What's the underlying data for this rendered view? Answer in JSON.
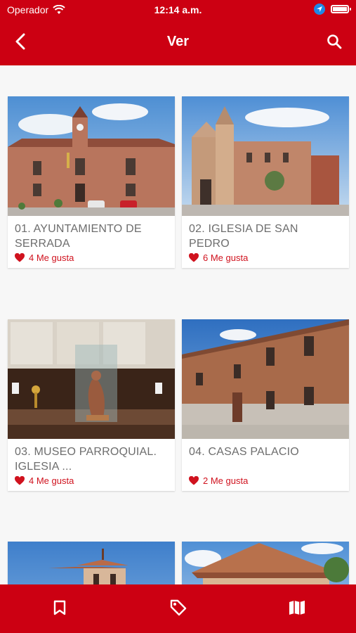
{
  "status": {
    "carrier": "Operador",
    "time": "12:14 a.m."
  },
  "appbar": {
    "title": "Ver"
  },
  "items": [
    {
      "name": "01. AYUNTAMIENTO DE SERRADA",
      "likes": "4 Me gusta"
    },
    {
      "name": "02. IGLESIA DE SAN PEDRO",
      "likes": "6 Me gusta"
    },
    {
      "name": "03. MUSEO PARROQUIAL. IGLESIA ...",
      "likes": "4 Me gusta"
    },
    {
      "name": "04. CASAS PALACIO",
      "likes": "2 Me gusta"
    }
  ],
  "tabs": [
    {
      "icon": "bookmark-icon"
    },
    {
      "icon": "tag-icon"
    },
    {
      "icon": "map-icon"
    }
  ],
  "colors": {
    "primary": "#cc0012",
    "like": "#d0121e",
    "text": "#6d6d6d"
  }
}
